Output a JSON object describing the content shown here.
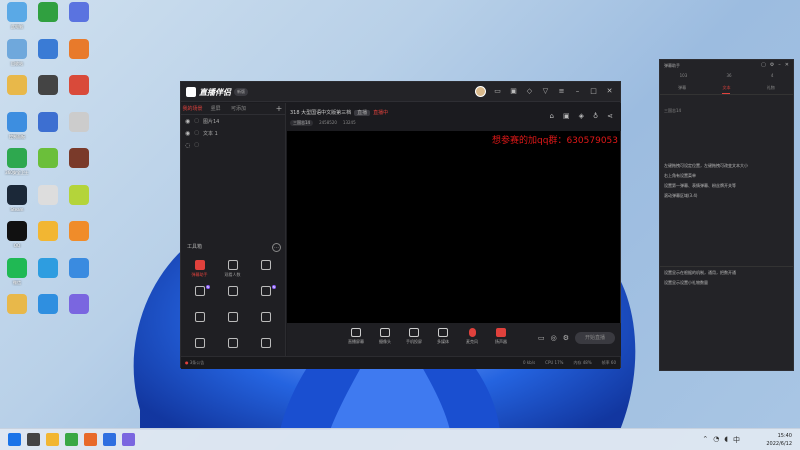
{
  "colors": {
    "accent_red": "#e0413c",
    "qq_red": "#e01818",
    "window_bg": "#1b1b1f"
  },
  "desktop": {
    "icons": [
      {
        "label": "此电脑",
        "icon": "computer-icon",
        "color": "#5aa9e6"
      },
      {
        "label": "回收站",
        "icon": "recycle-bin-icon",
        "color": "#6fa8dc"
      },
      {
        "label": "",
        "icon": "folder-icon",
        "color": "#e8b84a"
      },
      {
        "label": "控制面板",
        "icon": "control-panel-icon",
        "color": "#3d8ee0"
      },
      {
        "label": "360安全卫士",
        "icon": "shield-icon",
        "color": "#2ea84f"
      },
      {
        "label": "Steam",
        "icon": "steam-icon",
        "color": "#1b2838"
      },
      {
        "label": "QQ",
        "icon": "qq-icon",
        "color": "#111111"
      },
      {
        "label": "微信",
        "icon": "wechat-icon",
        "color": "#20b954"
      },
      {
        "label": "",
        "icon": "folder-icon-2",
        "color": "#e8b84a"
      },
      {
        "label": "",
        "icon": "app-icon-green-plus",
        "color": "#30a040"
      },
      {
        "label": "",
        "icon": "app-icon-bird",
        "color": "#3a7bd5"
      },
      {
        "label": "",
        "icon": "app-icon-person",
        "color": "#444444"
      },
      {
        "label": "",
        "icon": "app-icon-cartoon",
        "color": "#3d6fd1"
      },
      {
        "label": "",
        "icon": "app-icon-leaf",
        "color": "#6bbf3a"
      },
      {
        "label": "",
        "icon": "app-icon-circle",
        "color": "#dddddd"
      },
      {
        "label": "",
        "icon": "app-icon-yellow",
        "color": "#f2b632"
      },
      {
        "label": "",
        "icon": "app-icon-ie",
        "color": "#2e9de0"
      },
      {
        "label": "",
        "icon": "app-icon-rings",
        "color": "#2f8fe0"
      },
      {
        "label": "",
        "icon": "app-icon-swirl",
        "color": "#5a73e0"
      },
      {
        "label": "",
        "icon": "app-icon-orange",
        "color": "#e87a2b"
      },
      {
        "label": "",
        "icon": "app-icon-red",
        "color": "#d94a3a"
      },
      {
        "label": "",
        "icon": "app-icon-grid",
        "color": "#cccccc"
      },
      {
        "label": "",
        "icon": "app-icon-char",
        "color": "#7a3a2a"
      },
      {
        "label": "",
        "icon": "app-icon-lime",
        "color": "#b4d43a"
      },
      {
        "label": "",
        "icon": "app-icon-orange-ring",
        "color": "#f08c2a"
      },
      {
        "label": "",
        "icon": "app-icon-blue-bird",
        "color": "#3a8be0"
      },
      {
        "label": "",
        "icon": "app-icon-search",
        "color": "#7a66e0"
      }
    ]
  },
  "app": {
    "logo_text": "直播伴侣",
    "version_badge": "新版",
    "scene_tabs": [
      "我的场景",
      "竖屏",
      "可添加"
    ],
    "sources": [
      {
        "label": "图片14",
        "dim": false
      },
      {
        "label": "文本 1",
        "dim": false
      },
      {
        "label": "",
        "dim": true
      }
    ],
    "toolbox_title": "工具箱",
    "tools": [
      {
        "label": "弹幕助手",
        "active": true,
        "badge": ""
      },
      {
        "label": "观看人数",
        "active": false,
        "badge": ""
      },
      {
        "label": "",
        "active": false,
        "badge": ""
      },
      {
        "label": "",
        "active": false,
        "badge": "N"
      },
      {
        "label": "",
        "active": false,
        "badge": ""
      },
      {
        "label": "",
        "active": false,
        "badge": "N"
      },
      {
        "label": "",
        "active": false,
        "badge": ""
      },
      {
        "label": "",
        "active": false,
        "badge": ""
      },
      {
        "label": "",
        "active": false,
        "badge": ""
      },
      {
        "label": "",
        "active": false,
        "badge": ""
      },
      {
        "label": "",
        "active": false,
        "badge": ""
      },
      {
        "label": "",
        "active": false,
        "badge": ""
      }
    ],
    "room": {
      "title": "318 大型国语中文版第三档",
      "badge": "直播",
      "red": "直播中",
      "meta_pill": "三国志14",
      "stat1": "2458520",
      "stat2": "13245"
    },
    "qq_overlay": "想参赛的加qq群：630579053",
    "bottom_tools": [
      {
        "label": "直播屏幕",
        "kind": ""
      },
      {
        "label": "摄像头",
        "kind": ""
      },
      {
        "label": "手机投屏",
        "kind": ""
      },
      {
        "label": "多媒体",
        "kind": ""
      },
      {
        "label": "麦克风",
        "kind": "mic"
      },
      {
        "label": "扬声器",
        "kind": "spk"
      }
    ],
    "live_button": "开始直播",
    "status_left": "3条公告",
    "status_right": [
      "0 kb/s",
      "CPU 17%",
      "内存 48%",
      "帧率 60"
    ]
  },
  "side_panel": {
    "title": "弹幕助手",
    "stats": [
      "103",
      "36",
      "4"
    ],
    "tabs": [
      "弹幕",
      "文本",
      "礼物"
    ],
    "active_tab": 1,
    "lines": [
      {
        "text": "三国志14",
        "dim": true
      },
      {
        "text": "左键拖拽可设定位置，左键拖拽可改变文本大小",
        "dim": false
      },
      {
        "text": "右上角有设置菜单",
        "dim": false
      },
      {
        "text": "设置第一弹幕、表情弹幕、粉丝牌开关等",
        "dim": false
      },
      {
        "text": "滚动弹幕区域(3.4)",
        "dim": false
      },
      {
        "text": "设置显示在根据的机制，通用，把数开通",
        "dim": false
      },
      {
        "text": "设置显示设置小礼物数量",
        "dim": false
      }
    ]
  },
  "taskbar": {
    "apps": [
      {
        "icon": "windows-start-icon",
        "color": "#1a73e8"
      },
      {
        "icon": "search-icon",
        "color": "#444444"
      },
      {
        "icon": "file-explorer-icon",
        "color": "#f2b632"
      },
      {
        "icon": "green-app-icon",
        "color": "#3aa845"
      },
      {
        "icon": "orange-app-icon",
        "color": "#e86a2a"
      },
      {
        "icon": "blue-app-icon",
        "color": "#2f6fe0"
      },
      {
        "icon": "browser-icon",
        "color": "#7a66e0"
      }
    ],
    "time": "15:40",
    "date": "2022/6/12"
  }
}
